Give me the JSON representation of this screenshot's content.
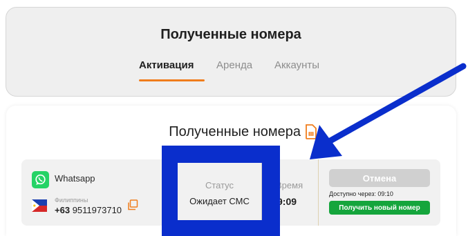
{
  "header": {
    "title": "Полученные номера",
    "tabs": [
      {
        "label": "Активация",
        "active": true
      },
      {
        "label": "Аренда",
        "active": false
      },
      {
        "label": "Аккаунты",
        "active": false
      }
    ]
  },
  "main": {
    "title": "Полученные номера",
    "sim_icon": "sim-card-icon"
  },
  "order": {
    "service": {
      "name": "Whatsapp",
      "icon": "whatsapp-icon"
    },
    "country": {
      "name": "Филиппины",
      "flag": "philippines-flag-icon"
    },
    "phone": {
      "code": "+63",
      "number": "9511973710"
    },
    "copy_icon": "copy-icon",
    "status": {
      "label": "Статус",
      "value": "Ожидает СМС"
    },
    "time": {
      "label": "Время",
      "value": "9:09"
    },
    "cancel_label": "Отмена",
    "available_text": "Доступно через: 09:10",
    "new_number_label": "Получить новый номер"
  },
  "colors": {
    "accent": "#f07d1c",
    "green": "#15a53c",
    "annotation_blue": "#0a2ecc",
    "whatsapp": "#25d366"
  }
}
